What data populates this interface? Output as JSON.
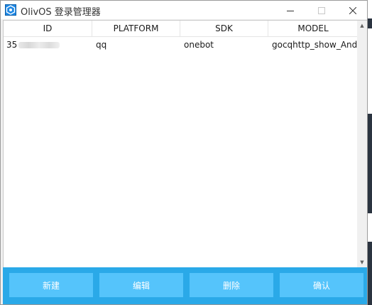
{
  "window": {
    "title": "OlivOS 登录管理器",
    "icon": "olivos-app-icon",
    "controls": [
      "minimize-icon",
      "maximize-icon",
      "close-icon"
    ]
  },
  "table": {
    "columns": [
      "ID",
      "PLATFORM",
      "SDK",
      "MODEL"
    ],
    "rows": [
      {
        "id": "35",
        "platform": "qq",
        "sdk": "onebot",
        "model": "gocqhttp_show_Andr"
      }
    ]
  },
  "buttons": {
    "new": "新建",
    "edit": "编辑",
    "delete": "删除",
    "confirm": "确认"
  },
  "colors": {
    "button_bar": "#2aa9e8",
    "button": "#55c4fb",
    "button_text": "#ffffff"
  }
}
